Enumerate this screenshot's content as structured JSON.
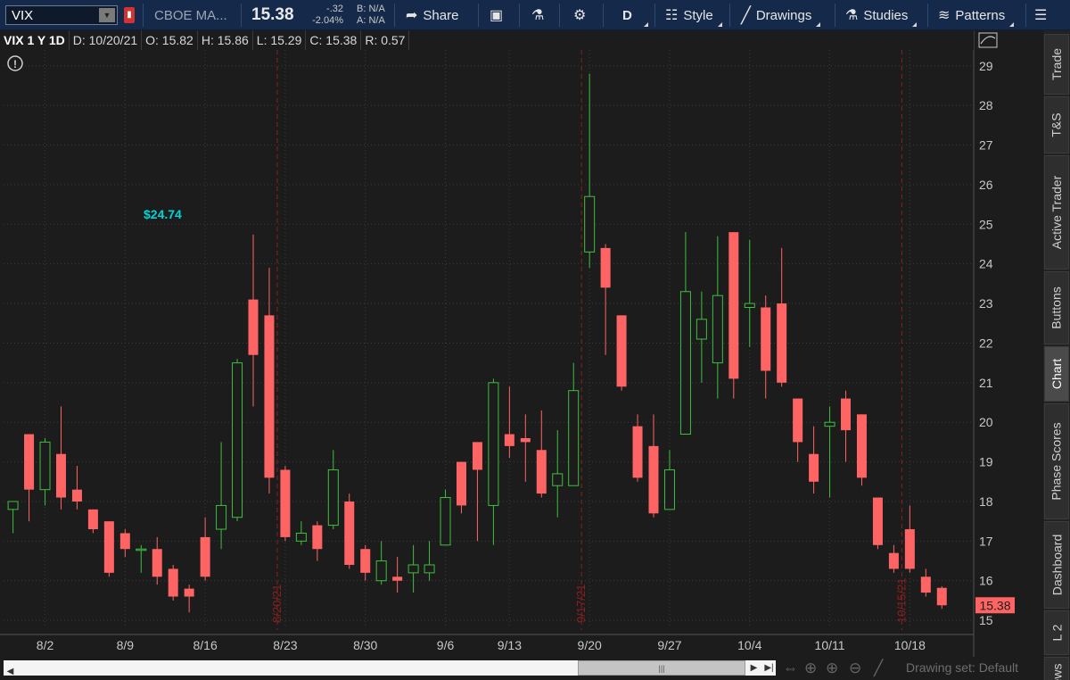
{
  "toolbar": {
    "symbol": "VIX",
    "company": "CBOE MA...",
    "last": "15.38",
    "net_change": "-.32",
    "pct_change": "-2.04%",
    "bid": "B: N/A",
    "ask": "A: N/A",
    "share_label": "Share",
    "period_label": "D",
    "style_label": "Style",
    "drawings_label": "Drawings",
    "studies_label": "Studies",
    "patterns_label": "Patterns"
  },
  "infobar": {
    "symbol_period": "VIX 1 Y 1D",
    "date": "D: 10/20/21",
    "open": "O: 15.82",
    "high": "H: 15.86",
    "low": "L: 15.29",
    "close": "C: 15.38",
    "range": "R: 0.57"
  },
  "right_tabs": [
    "Trade",
    "T&S",
    "Active Trader",
    "Buttons",
    "Chart",
    "Phase Scores",
    "Dashboard",
    "L 2",
    "News"
  ],
  "active_tab": "Chart",
  "drawing_set": "Drawing set: Default",
  "colors": {
    "up": "#3fbf3f",
    "down": "#ff6464",
    "marker": "#00d4d4",
    "expiry": "#8b2020",
    "price_tag": "#ff6464"
  },
  "chart_data": {
    "type": "candlestick",
    "ylim": [
      14.8,
      29.4
    ],
    "y_ticks": [
      15,
      16,
      17,
      18,
      19,
      20,
      21,
      22,
      23,
      24,
      25,
      26,
      27,
      28,
      29
    ],
    "x_ticks": [
      {
        "label": "8/2",
        "index": 2
      },
      {
        "label": "8/9",
        "index": 7
      },
      {
        "label": "8/16",
        "index": 12
      },
      {
        "label": "8/23",
        "index": 17
      },
      {
        "label": "8/30",
        "index": 22
      },
      {
        "label": "9/6",
        "index": 27
      },
      {
        "label": "9/13",
        "index": 31
      },
      {
        "label": "9/20",
        "index": 36
      },
      {
        "label": "9/27",
        "index": 41
      },
      {
        "label": "10/4",
        "index": 46
      },
      {
        "label": "10/11",
        "index": 51
      },
      {
        "label": "10/18",
        "index": 56
      }
    ],
    "expiry_markers": [
      {
        "label": "8/20/21",
        "index": 16.5
      },
      {
        "label": "9/17/21",
        "index": 35.5
      },
      {
        "label": "10/15/21",
        "index": 55.5
      }
    ],
    "high_marker": {
      "label": "$24.74",
      "index": 15,
      "value": 24.74
    },
    "last_price_tag": "15.38",
    "candles": [
      {
        "o": 17.8,
        "h": 18.0,
        "l": 17.2,
        "c": 18.0
      },
      {
        "o": 19.7,
        "h": 19.7,
        "l": 17.5,
        "c": 18.3
      },
      {
        "o": 18.3,
        "h": 19.6,
        "l": 17.9,
        "c": 19.5
      },
      {
        "o": 19.2,
        "h": 20.4,
        "l": 17.8,
        "c": 18.1
      },
      {
        "o": 18.3,
        "h": 18.9,
        "l": 17.8,
        "c": 18.0
      },
      {
        "o": 17.8,
        "h": 17.8,
        "l": 17.2,
        "c": 17.3
      },
      {
        "o": 17.5,
        "h": 17.5,
        "l": 16.1,
        "c": 16.2
      },
      {
        "o": 17.2,
        "h": 17.3,
        "l": 16.6,
        "c": 16.8
      },
      {
        "o": 16.8,
        "h": 16.9,
        "l": 16.2,
        "c": 16.8
      },
      {
        "o": 16.8,
        "h": 17.1,
        "l": 15.9,
        "c": 16.1
      },
      {
        "o": 16.3,
        "h": 16.4,
        "l": 15.5,
        "c": 15.6
      },
      {
        "o": 15.8,
        "h": 15.9,
        "l": 15.2,
        "c": 15.6
      },
      {
        "o": 17.1,
        "h": 17.6,
        "l": 16.0,
        "c": 16.1
      },
      {
        "o": 17.3,
        "h": 19.5,
        "l": 16.8,
        "c": 17.9
      },
      {
        "o": 17.6,
        "h": 21.6,
        "l": 17.5,
        "c": 21.5
      },
      {
        "o": 23.1,
        "h": 24.74,
        "l": 20.4,
        "c": 21.7
      },
      {
        "o": 22.7,
        "h": 23.9,
        "l": 18.2,
        "c": 18.6
      },
      {
        "o": 18.8,
        "h": 18.9,
        "l": 17.0,
        "c": 17.1
      },
      {
        "o": 17.0,
        "h": 17.5,
        "l": 16.9,
        "c": 17.2
      },
      {
        "o": 17.4,
        "h": 17.5,
        "l": 16.5,
        "c": 16.8
      },
      {
        "o": 17.4,
        "h": 19.3,
        "l": 17.3,
        "c": 18.8
      },
      {
        "o": 18.0,
        "h": 18.2,
        "l": 16.3,
        "c": 16.4
      },
      {
        "o": 16.8,
        "h": 16.9,
        "l": 16.0,
        "c": 16.2
      },
      {
        "o": 16.0,
        "h": 17.0,
        "l": 15.9,
        "c": 16.5
      },
      {
        "o": 16.1,
        "h": 16.6,
        "l": 15.7,
        "c": 16.0
      },
      {
        "o": 16.2,
        "h": 16.9,
        "l": 15.7,
        "c": 16.4
      },
      {
        "o": 16.2,
        "h": 17.0,
        "l": 16.0,
        "c": 16.4
      },
      {
        "o": 16.9,
        "h": 18.3,
        "l": 16.9,
        "c": 18.1
      },
      {
        "o": 19.0,
        "h": 19.0,
        "l": 17.7,
        "c": 17.9
      },
      {
        "o": 19.5,
        "h": 19.5,
        "l": 17.0,
        "c": 18.8
      },
      {
        "o": 17.9,
        "h": 21.1,
        "l": 16.9,
        "c": 21.0
      },
      {
        "o": 19.7,
        "h": 20.9,
        "l": 19.1,
        "c": 19.4
      },
      {
        "o": 19.6,
        "h": 20.2,
        "l": 18.5,
        "c": 19.5
      },
      {
        "o": 19.3,
        "h": 20.3,
        "l": 18.1,
        "c": 18.2
      },
      {
        "o": 18.4,
        "h": 19.8,
        "l": 17.6,
        "c": 18.7
      },
      {
        "o": 18.4,
        "h": 21.5,
        "l": 18.4,
        "c": 20.8
      },
      {
        "o": 24.3,
        "h": 28.8,
        "l": 23.9,
        "c": 25.7
      },
      {
        "o": 24.4,
        "h": 24.5,
        "l": 21.7,
        "c": 23.4
      },
      {
        "o": 22.7,
        "h": 22.7,
        "l": 20.8,
        "c": 20.9
      },
      {
        "o": 19.9,
        "h": 20.2,
        "l": 18.5,
        "c": 18.6
      },
      {
        "o": 19.4,
        "h": 20.2,
        "l": 17.6,
        "c": 17.7
      },
      {
        "o": 17.8,
        "h": 19.3,
        "l": 17.8,
        "c": 18.8
      },
      {
        "o": 19.7,
        "h": 24.8,
        "l": 19.7,
        "c": 23.3
      },
      {
        "o": 22.1,
        "h": 23.3,
        "l": 21.0,
        "c": 22.6
      },
      {
        "o": 21.5,
        "h": 24.7,
        "l": 20.6,
        "c": 23.2
      },
      {
        "o": 24.8,
        "h": 24.8,
        "l": 20.6,
        "c": 21.1
      },
      {
        "o": 22.9,
        "h": 24.6,
        "l": 21.9,
        "c": 23.0
      },
      {
        "o": 22.9,
        "h": 23.2,
        "l": 20.6,
        "c": 21.3
      },
      {
        "o": 23.0,
        "h": 24.4,
        "l": 20.9,
        "c": 21.0
      },
      {
        "o": 20.6,
        "h": 20.6,
        "l": 19.0,
        "c": 19.5
      },
      {
        "o": 19.2,
        "h": 19.9,
        "l": 18.2,
        "c": 18.5
      },
      {
        "o": 19.9,
        "h": 20.4,
        "l": 18.1,
        "c": 20.0
      },
      {
        "o": 20.6,
        "h": 20.8,
        "l": 19.0,
        "c": 19.8
      },
      {
        "o": 20.2,
        "h": 20.2,
        "l": 18.4,
        "c": 18.6
      },
      {
        "o": 18.1,
        "h": 18.1,
        "l": 16.8,
        "c": 16.9
      },
      {
        "o": 16.7,
        "h": 16.9,
        "l": 16.2,
        "c": 16.3
      },
      {
        "o": 17.3,
        "h": 17.9,
        "l": 16.2,
        "c": 16.3
      },
      {
        "o": 16.1,
        "h": 16.3,
        "l": 15.6,
        "c": 15.7
      },
      {
        "o": 15.82,
        "h": 15.86,
        "l": 15.29,
        "c": 15.38
      }
    ]
  }
}
